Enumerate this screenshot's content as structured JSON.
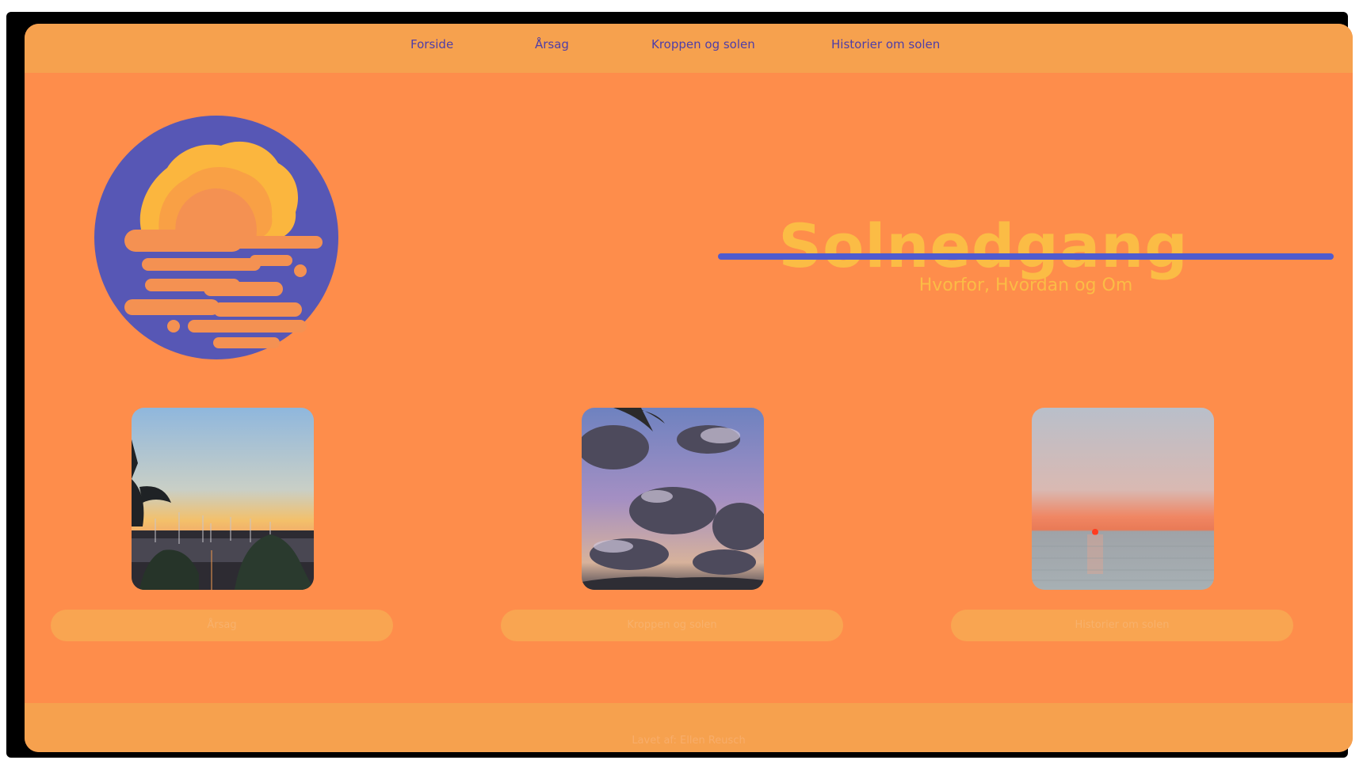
{
  "nav": {
    "items": [
      {
        "label": "Forside"
      },
      {
        "label": "Årsag"
      },
      {
        "label": "Kroppen og solen"
      },
      {
        "label": "Historier om solen"
      }
    ]
  },
  "hero": {
    "title": "Solnedgang",
    "subtitle": "Hvorfor, Hvordan og Om"
  },
  "cards": [
    {
      "image": "harbor-sunset-photo",
      "button_label": "Årsag"
    },
    {
      "image": "cloudy-sky-palm-photo",
      "button_label": "Kroppen og solen"
    },
    {
      "image": "sea-sunset-photo",
      "button_label": "Historier om solen"
    }
  ],
  "footer": {
    "credit": "Lavet af: Ellen Reusch"
  },
  "colors": {
    "page_background": "#fe8d4b",
    "bar_background": "#f6a14e",
    "nav_text": "#4e3ea8",
    "title": "#fbbc45",
    "accent_blue": "#4f5bcf"
  }
}
